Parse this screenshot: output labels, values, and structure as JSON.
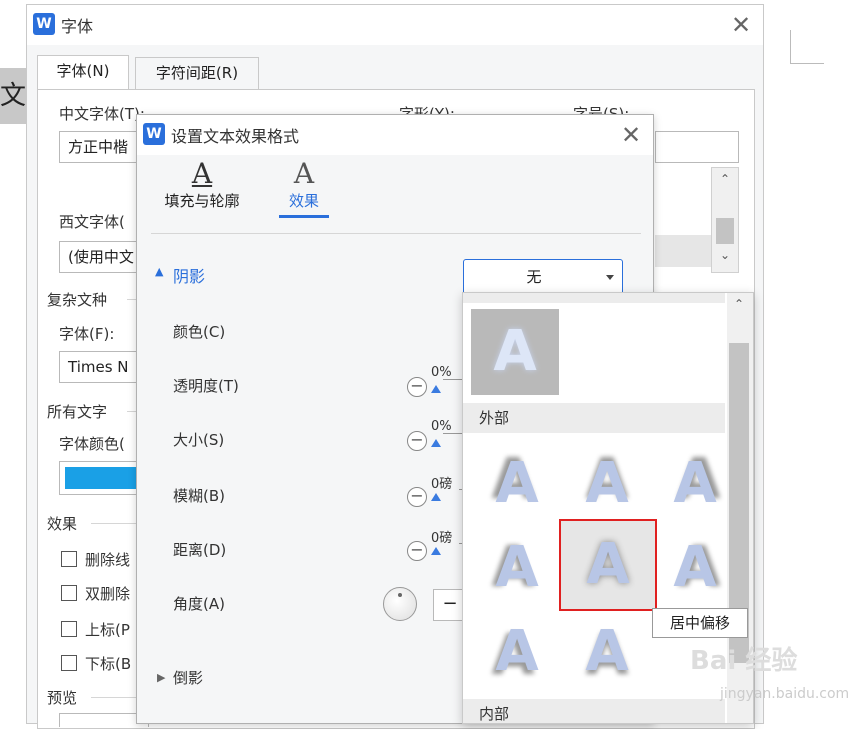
{
  "background": {
    "doc_text": "文字"
  },
  "font_dialog": {
    "title": "字体",
    "logo": "W",
    "close": "✕",
    "tabs": [
      {
        "label": "字体(N)"
      },
      {
        "label": "字符间距(R)"
      }
    ],
    "chinese_font": {
      "label": "中文字体(T):",
      "value": "方正中楷"
    },
    "style": {
      "label": "字形(Y):"
    },
    "size": {
      "label": "字号(S):"
    },
    "western_font": {
      "label": "西文字体(",
      "value": "(使用中文"
    },
    "complex": {
      "section": "复杂文种",
      "font_label": "字体(F):",
      "font_value": "Times N"
    },
    "all_text": {
      "section": "所有文字",
      "color_label": "字体颜色(",
      "color": "#1aa0e6"
    },
    "effects": {
      "section": "效果",
      "items": [
        {
          "label": "删除线"
        },
        {
          "label": "双删除"
        },
        {
          "label": "上标(P"
        },
        {
          "label": "下标(B"
        }
      ]
    },
    "preview": {
      "section": "预览"
    }
  },
  "fx_dialog": {
    "title": "设置文本效果格式",
    "logo": "W",
    "close": "✕",
    "tabs": [
      {
        "label": "填充与轮廓",
        "icon": "A"
      },
      {
        "label": "效果",
        "icon": "A"
      }
    ],
    "shadow": {
      "label": "阴影",
      "dropdown_value": "无"
    },
    "rows": [
      {
        "label": "颜色(C)",
        "value": ""
      },
      {
        "label": "透明度(T)",
        "value": "0%"
      },
      {
        "label": "大小(S)",
        "value": "0%"
      },
      {
        "label": "模糊(B)",
        "value": "0磅"
      },
      {
        "label": "距离(D)",
        "value": "0磅"
      },
      {
        "label": "角度(A)",
        "value": ""
      }
    ],
    "reflection": {
      "label": "倒影"
    },
    "accent_color": "#2a6fdb"
  },
  "shadow_gallery": {
    "categories": [
      {
        "label": "外部"
      },
      {
        "label": "内部"
      }
    ],
    "glyph": "A",
    "selected_tooltip": "居中偏移"
  },
  "watermark": {
    "main": "Bai 经验",
    "sub": "jingyan.baidu.com"
  }
}
